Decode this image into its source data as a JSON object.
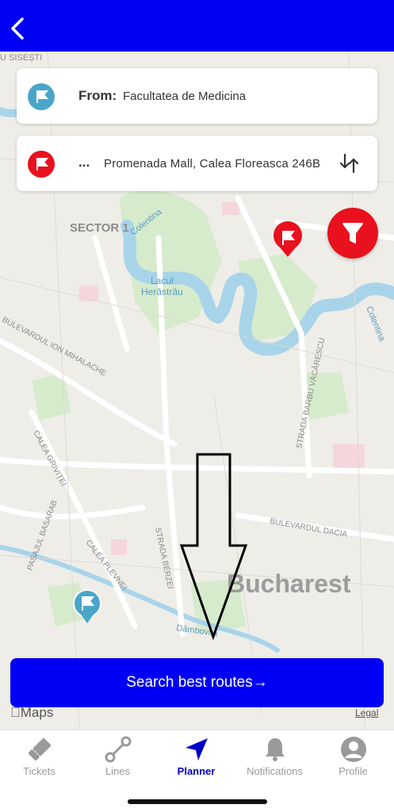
{
  "header": {
    "back_icon": "chevron-left-icon"
  },
  "route": {
    "from_label": "From:",
    "from_value": "Facultatea de Medicina",
    "to_label": "...",
    "to_value": "Promenada Mall, Calea Floreasca 246B",
    "from_color": "#4aa6c8",
    "to_color": "#e8111d"
  },
  "map": {
    "labels": {
      "sector": "SECTOR 1",
      "colentina_top": "Colentina",
      "lake": "Lacul\nHerăstrău",
      "colentina_right": "Colentina",
      "ion_mihalache": "BULEVARDUL ION MIHALACHE",
      "barbu_vacarescu": "STRADA BARBU VĂCĂRESCU",
      "grivitei": "CALEA GRIVIȚEI",
      "basarab": "PASAJUL BASARAB",
      "plevnei": "CALEA PLEVNEI",
      "berzei": "STRADA BERZEI",
      "dacia": "BULEVARDUL DACIA",
      "city": "Bucharest",
      "dambovita": "Dâmbovița",
      "sisesti": "U SISEȘTI"
    }
  },
  "search": {
    "label": "Search best routes",
    "arrow": "→"
  },
  "attribution": {
    "maps": "Maps",
    "legal": "Legal"
  },
  "tabs": [
    {
      "label": "Tickets",
      "icon": "ticket-icon"
    },
    {
      "label": "Lines",
      "icon": "route-icon"
    },
    {
      "label": "Planner",
      "icon": "navigation-arrow-icon",
      "active": true
    },
    {
      "label": "Notifications",
      "icon": "bell-icon"
    },
    {
      "label": "Profile",
      "icon": "profile-icon"
    }
  ],
  "colors": {
    "accent": "#0000f5",
    "filter": "#e8111d",
    "water": "#a8d4ea",
    "park": "#cfe6c4"
  }
}
